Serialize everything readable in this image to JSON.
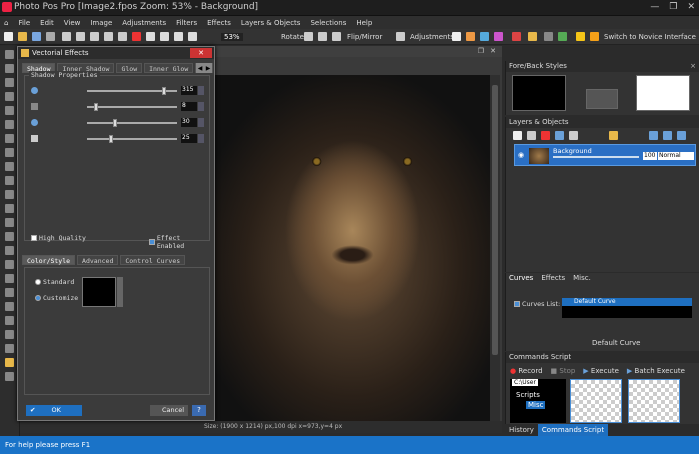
{
  "window": {
    "title": "Photo Pos Pro [Image2.fpos Zoom: 53% - Background]",
    "controls": [
      "—",
      "❐",
      "✕"
    ]
  },
  "menu": [
    "File",
    "Edit",
    "View",
    "Image",
    "Adjustments",
    "Filters",
    "Effects",
    "Layers & Objects",
    "Selections",
    "Help"
  ],
  "toolbar": {
    "zoom": "53%",
    "rotate_label": "Rotate:",
    "flip_label": "Flip/Mirror",
    "adjustments_label": "Adjustments:",
    "novice_label": "Switch to Novice Interface"
  },
  "dialog": {
    "title": "Vectorial Effects",
    "close": "✕",
    "tabs": [
      "Shadow",
      "Inner Shadow",
      "Glow",
      "Inner Glow",
      "Be"
    ],
    "tab_scroll": [
      "◀",
      "▶"
    ],
    "group_title": "Shadow Properties",
    "sliders": [
      {
        "value": "315",
        "fraction": 0.875
      },
      {
        "value": "8",
        "fraction": 0.08
      },
      {
        "value": "30",
        "fraction": 0.3
      },
      {
        "value": "25",
        "fraction": 0.25
      }
    ],
    "high_quality": "High Quality",
    "effect_enabled": "Effect Enabled",
    "tabs2": [
      "Color/Style",
      "Advanced",
      "Control Curves"
    ],
    "radio_standard": "Standard",
    "radio_customize": "Customize",
    "ok": "OK",
    "ok_check": "✔",
    "cancel": "Cancel",
    "help": "?"
  },
  "canvas": {
    "status": "Size: (1900 x 1214) px,100 dpi   x=973,y=4 px"
  },
  "help_text": "For help please press F1",
  "panels": {
    "fore_back": "Fore/Back Styles",
    "layers": "Layers & Objects",
    "layer_name": "Background",
    "layer_opacity": "100",
    "layer_mode": "Normal",
    "curves_tabs": [
      "Curves",
      "Effects",
      "Misc."
    ],
    "curves_list_label": "Curves List:",
    "curves_list_item": "Default Curve",
    "curves_bottom_item": "Default Curve",
    "commands": "Commands Script",
    "record": "Record",
    "stop": "Stop",
    "execute": "Execute",
    "batch": "Batch Execute",
    "path": "C:\\User",
    "scripts": "Scripts",
    "misc": "Misc",
    "close_x": "×"
  },
  "bottom_tabs": [
    "History",
    "Commands Script"
  ]
}
